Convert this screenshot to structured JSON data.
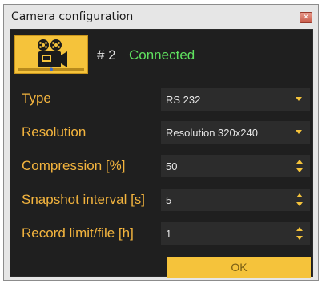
{
  "window": {
    "title": "Camera configuration"
  },
  "camera": {
    "number": "# 2",
    "status": "Connected",
    "logo_icon": "film-camera-icon"
  },
  "fields": [
    {
      "label": "Type",
      "value": "RS 232",
      "control": "dropdown"
    },
    {
      "label": "Resolution",
      "value": "Resolution 320x240",
      "control": "dropdown"
    },
    {
      "label": "Compression [%]",
      "value": "50",
      "control": "spinner"
    },
    {
      "label": "Snapshot interval [s]",
      "value": "5",
      "control": "spinner"
    },
    {
      "label": "Record limit/file [h]",
      "value": "1",
      "control": "spinner"
    }
  ],
  "ok_label": "OK",
  "colors": {
    "accent": "#f5c33b",
    "label": "#f3b43e",
    "status": "#5fe05f",
    "background": "#1f1f1f"
  }
}
